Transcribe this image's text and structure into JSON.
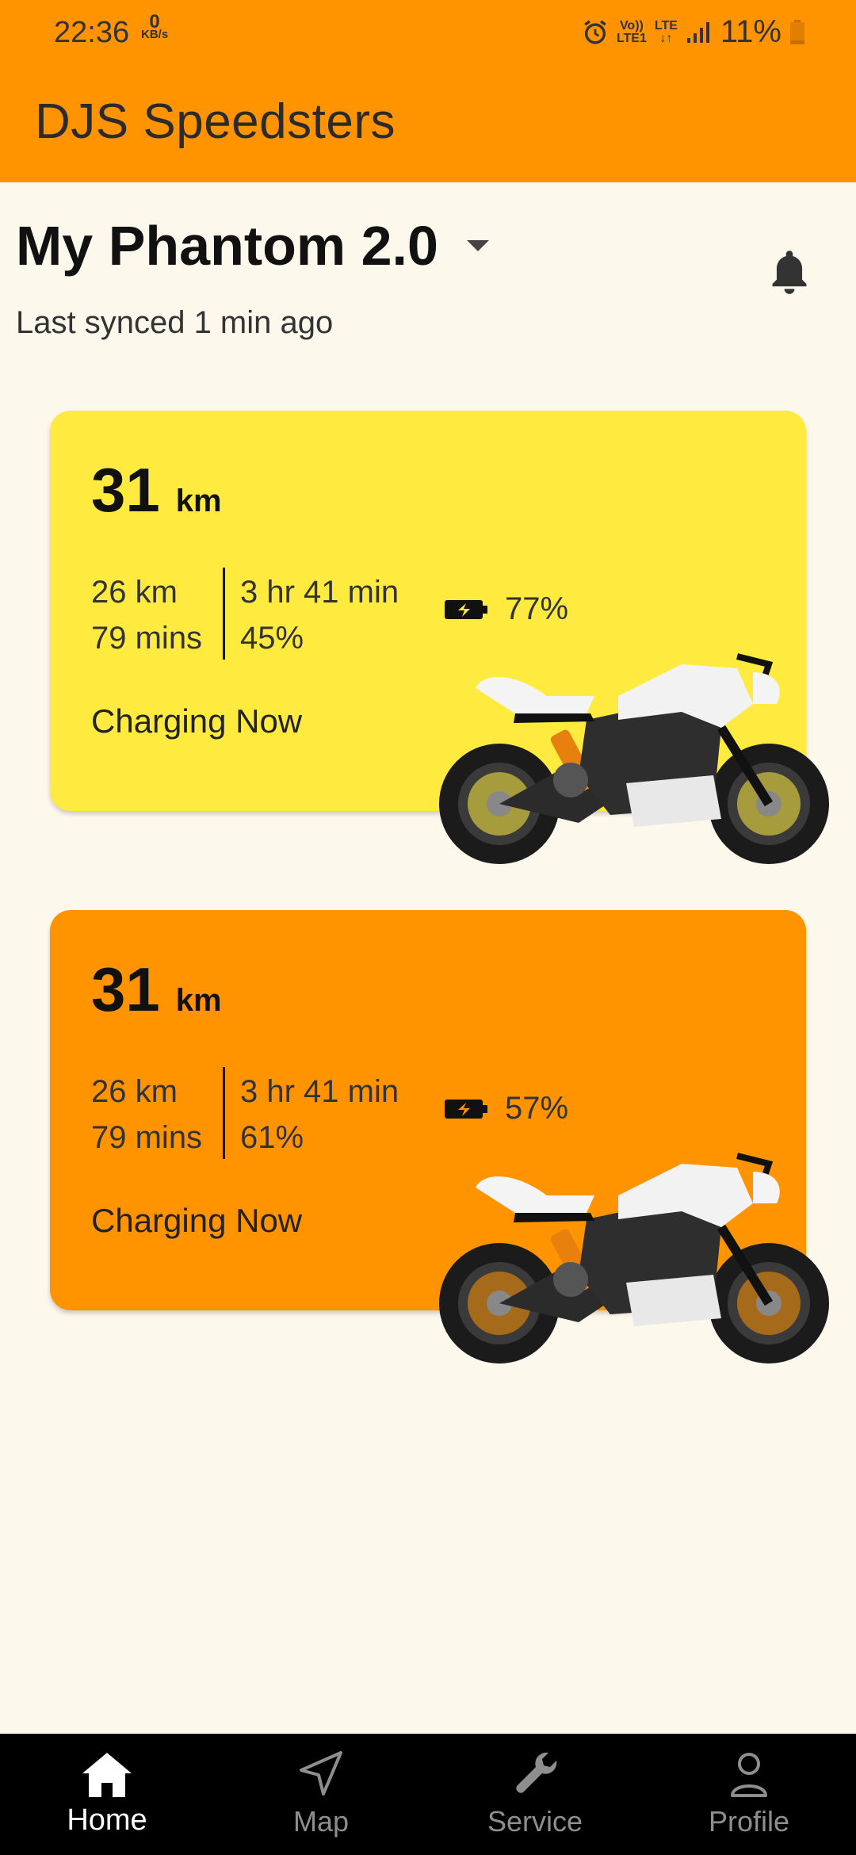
{
  "status_bar": {
    "time": "22:36",
    "net_speed_value": "0",
    "net_speed_unit": "KB/s",
    "volte_top": "Vo))",
    "volte_bottom": "LTE1",
    "lte_label": "LTE",
    "battery_percent": "11%"
  },
  "app": {
    "title": "DJS Speedsters"
  },
  "vehicle": {
    "name": "My Phantom 2.0",
    "last_synced": "Last synced 1 min ago"
  },
  "cards": [
    {
      "range_value": "31",
      "range_unit": "km",
      "distance": "26 km",
      "duration_mins": "79 mins",
      "time_remaining": "3 hr 41 min",
      "percent_secondary": "45%",
      "battery_percent": "77%",
      "status": "Charging Now",
      "color": "#FFEB3F"
    },
    {
      "range_value": "31",
      "range_unit": "km",
      "distance": "26 km",
      "duration_mins": "79 mins",
      "time_remaining": "3 hr 41 min",
      "percent_secondary": "61%",
      "battery_percent": "57%",
      "status": "Charging Now",
      "color": "#FF9400"
    }
  ],
  "bottom_nav": [
    {
      "label": "Home",
      "icon": "home-icon",
      "active": true
    },
    {
      "label": "Map",
      "icon": "navigation-icon",
      "active": false
    },
    {
      "label": "Service",
      "icon": "wrench-icon",
      "active": false
    },
    {
      "label": "Profile",
      "icon": "person-icon",
      "active": false
    }
  ],
  "colors": {
    "primary": "#FF9400",
    "accent_yellow": "#FFEB3F",
    "background": "#FDF8EC"
  }
}
